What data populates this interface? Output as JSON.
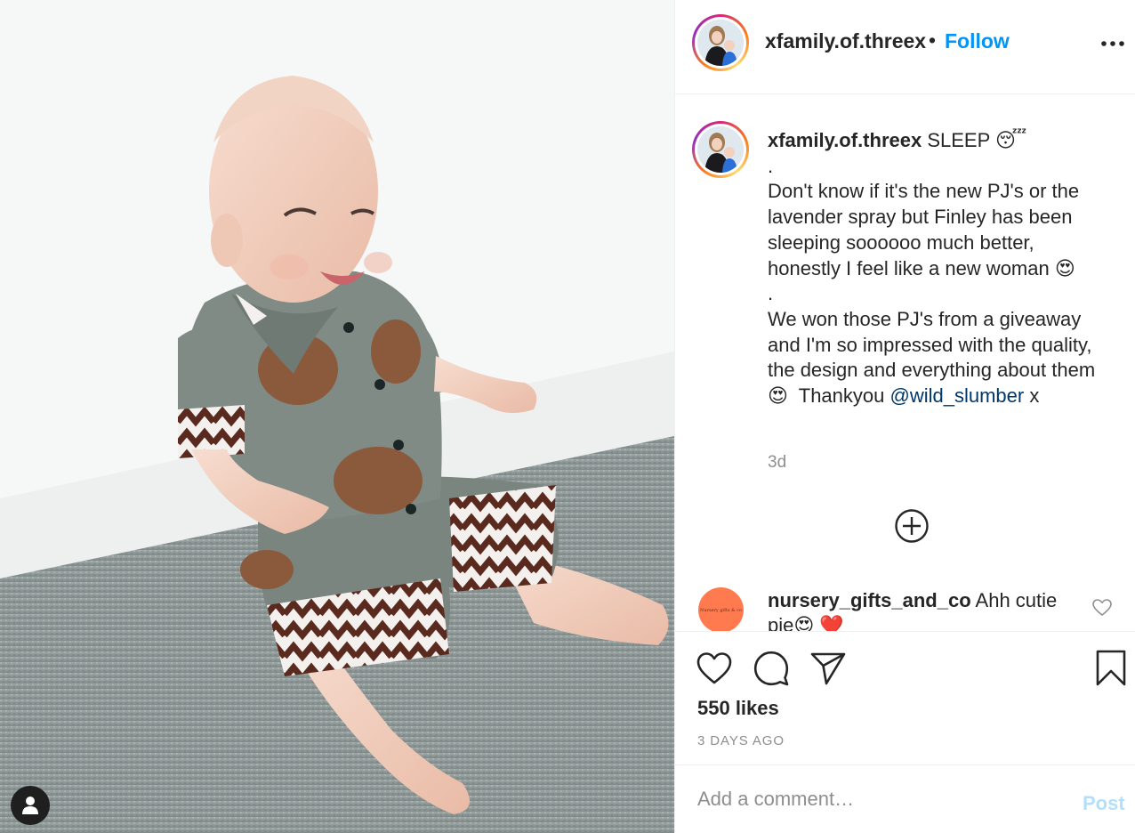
{
  "post": {
    "image_alt": "Smiling baby in bear-print pyjamas sitting on a grey carpet",
    "colors": {
      "accent": "#0095f6",
      "mention": "#00376b",
      "muted": "#8e8e8e",
      "post_disabled": "#b2dffc",
      "text": "#262626"
    }
  },
  "header": {
    "username": "xfamily.of.threex",
    "separator": "•",
    "follow_label": "Follow",
    "more_icon": "more-options-icon"
  },
  "caption": {
    "username": "xfamily.of.threex",
    "lines": [
      "SLEEP 😴",
      ".",
      "Don't know if it's the new PJ's or the lavender spray but Finley has been sleeping soooooo much better, honestly I feel like a new woman 😍",
      ".",
      "We won those PJ's from a giveaway and I'm so impressed with the quality, the design and everything about them 😍  Thankyou"
    ],
    "mention": "@wild_slumber",
    "end_text": " x",
    "time": "3d"
  },
  "load_more_icon": "plus-circle-icon",
  "comments": [
    {
      "username": "nursery_gifts_and_co",
      "text": "Ahh cutie pie😍 ❤️",
      "avatar_text": "Nursery gifts & co"
    }
  ],
  "actions": {
    "icons": [
      "heart-icon",
      "comment-icon",
      "share-icon",
      "bookmark-icon"
    ],
    "likes": "550 likes",
    "time_ago": "3 DAYS AGO"
  },
  "add_comment": {
    "placeholder": "Add a comment…",
    "post_label": "Post"
  },
  "user_tag_icon": "user-icon"
}
